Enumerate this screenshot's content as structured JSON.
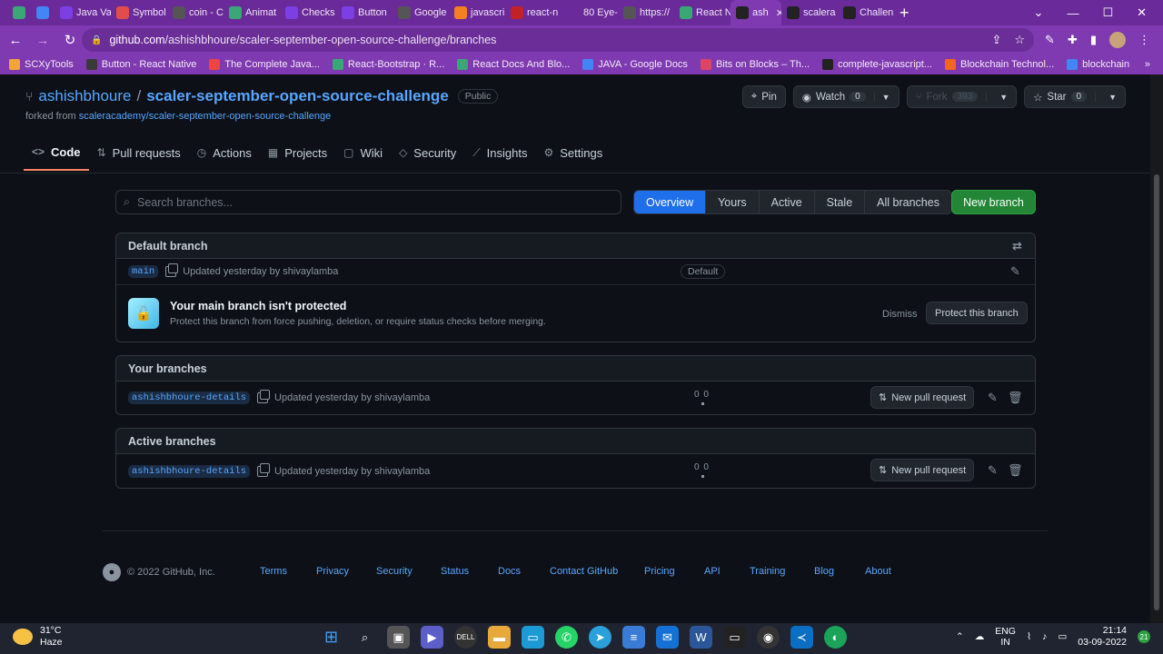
{
  "browser": {
    "tabs": [
      {
        "label": "",
        "fav": "#3aa776",
        "icon": "react-icon"
      },
      {
        "label": "",
        "fav": "#4285f4",
        "icon": "docs-icon"
      },
      {
        "label": "Java Va",
        "fav": "#7b3fe4",
        "icon": "java-icon"
      },
      {
        "label": "Symbol",
        "fav": "#e34c4c",
        "icon": "symbol-icon"
      },
      {
        "label": "coin - C",
        "fav": "#555",
        "icon": "google-icon"
      },
      {
        "label": "Animat",
        "fav": "#3aa776",
        "icon": "react-icon"
      },
      {
        "label": "Checks",
        "fav": "#7b3fe4",
        "icon": "bootstrap-icon"
      },
      {
        "label": "Button",
        "fav": "#7b3fe4",
        "icon": "bootstrap-icon"
      },
      {
        "label": "Google",
        "fav": "#555",
        "icon": "google-icon"
      },
      {
        "label": "javascri",
        "fav": "#f48024",
        "icon": "stackoverflow-icon"
      },
      {
        "label": "react-n",
        "fav": "#c12127",
        "icon": "npm-icon"
      },
      {
        "label": "80 Eye-",
        "fav": "#6a2a9a",
        "icon": "page-icon"
      },
      {
        "label": "https://",
        "fav": "#555",
        "icon": "google-icon"
      },
      {
        "label": "React N",
        "fav": "#3aa776",
        "icon": "react-icon"
      },
      {
        "label": "ash",
        "fav": "#222",
        "icon": "github-icon"
      },
      {
        "label": "scalera",
        "fav": "#222",
        "icon": "github-icon"
      },
      {
        "label": "Challen",
        "fav": "#222",
        "icon": "github-icon"
      }
    ],
    "active_tab_index": 14,
    "url_host": "github.com",
    "url_path": "/ashishbhoure/scaler-september-open-source-challenge/branches",
    "bookmarks": [
      {
        "label": "SCXyTools",
        "color": "#f2a33a"
      },
      {
        "label": "Button - React Native",
        "color": "#3a3a3a"
      },
      {
        "label": "The Complete Java...",
        "color": "#e44"
      },
      {
        "label": "React-Bootstrap · R...",
        "color": "#3aa776"
      },
      {
        "label": "React Docs And Blo...",
        "color": "#3aa776"
      },
      {
        "label": "JAVA - Google Docs",
        "color": "#4285f4"
      },
      {
        "label": "Bits on Blocks – Th...",
        "color": "#d46"
      },
      {
        "label": "complete-javascript...",
        "color": "#222"
      },
      {
        "label": "Blockchain Technol...",
        "color": "#f26522"
      },
      {
        "label": "blockchain",
        "color": "#4285f4"
      }
    ]
  },
  "repo": {
    "owner": "ashishbhoure",
    "name": "scaler-september-open-source-challenge",
    "visibility": "Public",
    "forked_prefix": "forked from",
    "forked_from": "scaleracademy/scaler-september-open-source-challenge",
    "pin_label": "Pin",
    "watch_label": "Watch",
    "watch_count": "0",
    "fork_label": "Fork",
    "fork_count": "393",
    "star_label": "Star",
    "star_count": "0"
  },
  "nav_tabs": [
    {
      "label": "Code",
      "icon": "code-icon"
    },
    {
      "label": "Pull requests",
      "icon": "pull-request-icon"
    },
    {
      "label": "Actions",
      "icon": "play-icon"
    },
    {
      "label": "Projects",
      "icon": "table-icon"
    },
    {
      "label": "Wiki",
      "icon": "book-icon"
    },
    {
      "label": "Security",
      "icon": "shield-icon"
    },
    {
      "label": "Insights",
      "icon": "graph-icon"
    },
    {
      "label": "Settings",
      "icon": "gear-icon"
    }
  ],
  "branches": {
    "search_placeholder": "Search branches...",
    "filters": [
      "Overview",
      "Yours",
      "Active",
      "Stale",
      "All branches"
    ],
    "new_branch_label": "New branch",
    "default_header": "Default branch",
    "default_branch": {
      "name": "main",
      "updated": "Updated yesterday by shivaylamba",
      "badge": "Default"
    },
    "protect": {
      "title": "Your main branch isn't protected",
      "description": "Protect this branch from force pushing, deletion, or require status checks before merging.",
      "dismiss": "Dismiss",
      "button": "Protect this branch"
    },
    "your_header": "Your branches",
    "your_branch": {
      "name": "ashishbhoure-details",
      "updated": "Updated yesterday by shivaylamba",
      "behind": "0",
      "ahead": "0",
      "pr_label": "New pull request"
    },
    "active_header": "Active branches",
    "active_branch": {
      "name": "ashishbhoure-details",
      "updated": "Updated yesterday by shivaylamba",
      "behind": "0",
      "ahead": "0",
      "pr_label": "New pull request"
    }
  },
  "footer": {
    "copyright": "© 2022 GitHub, Inc.",
    "links": [
      "Terms",
      "Privacy",
      "Security",
      "Status",
      "Docs",
      "Contact GitHub",
      "Pricing",
      "API",
      "Training",
      "Blog",
      "About"
    ]
  },
  "taskbar": {
    "temperature": "31°C",
    "weather": "Haze",
    "lang1": "ENG",
    "lang2": "IN",
    "time": "21:14",
    "date": "03-09-2022",
    "notifications": "21"
  },
  "colors": {
    "accent": "#1f6feb",
    "primary_button": "#238636",
    "browser_frame": "#7f39b1"
  }
}
